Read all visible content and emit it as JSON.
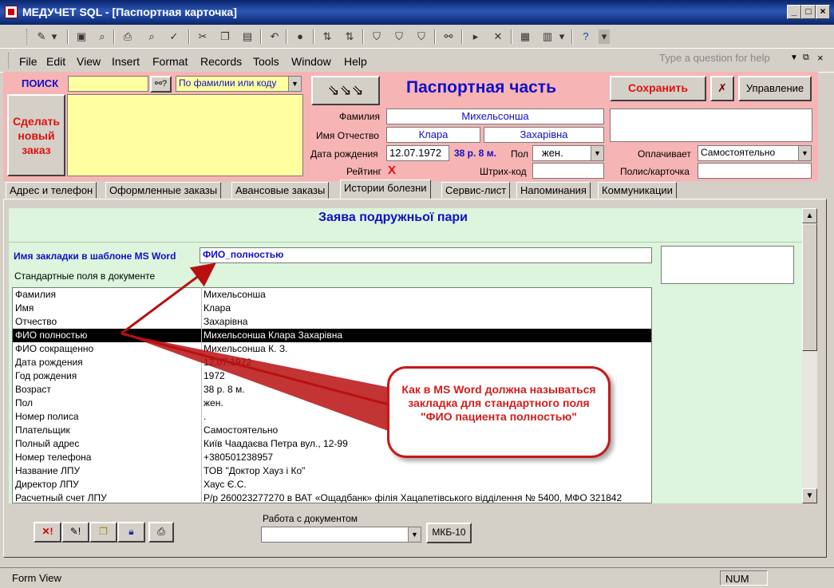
{
  "window": {
    "title": "МЕДУЧЕТ SQL - [Паспортная карточка]"
  },
  "menu": [
    "File",
    "Edit",
    "View",
    "Insert",
    "Format",
    "Records",
    "Tools",
    "Window",
    "Help"
  ],
  "help_placeholder": "Type a question for help",
  "search": {
    "label": "ПОИСК",
    "value": "",
    "mode": "По фамилии или коду"
  },
  "new_order_button": "Сделать новый заказ",
  "section_title": "Паспортная часть",
  "save_button": "Сохранить",
  "manage_button": "Управление",
  "patient": {
    "surname_label": "Фамилия",
    "surname": "Михельсонша",
    "name_label": "Имя Отчество",
    "first_name": "Клара",
    "patronymic": "Захарівна",
    "dob_label": "Дата рождения",
    "dob": "12.07.1972",
    "age": "38 р. 8 м.",
    "sex_label": "Пол",
    "sex": "жен.",
    "rating_label": "Рейтинг",
    "rating_mark": "X",
    "barcode_label": "Штрих-код",
    "barcode": "",
    "payer_label": "Оплачивает",
    "payer": "Самостоятельно",
    "policy_label": "Полис/карточка",
    "policy": ""
  },
  "tabs": [
    "Адрес и телефон",
    "Оформленные заказы",
    "Авансовые заказы",
    "Истории болезни",
    "Сервис-лист",
    "Напоминания",
    "Коммуникации"
  ],
  "active_tab": 3,
  "form": {
    "heading": "Заява подружньої пари",
    "bookmark_label": "Имя закладки в шаблоне MS Word",
    "bookmark_value": "ФИО_полностью",
    "std_fields_label": "Стандартные поля в документе",
    "rows": [
      {
        "k": "Фамилия",
        "v": "Михельсонша"
      },
      {
        "k": "Имя",
        "v": "Клара"
      },
      {
        "k": "Отчество",
        "v": "Захарівна"
      },
      {
        "k": "ФИО полностью",
        "v": "Михельсонша Клара Захарівна"
      },
      {
        "k": "ФИО сокращенно",
        "v": "Михельсонша К. З."
      },
      {
        "k": "Дата рождения",
        "v": "12.07.1972"
      },
      {
        "k": "Год рождения",
        "v": "1972"
      },
      {
        "k": "Возраст",
        "v": "38 р. 8 м."
      },
      {
        "k": "Пол",
        "v": "жен."
      },
      {
        "k": "Номер полиса",
        "v": "."
      },
      {
        "k": "Плательщик",
        "v": "Самостоятельно"
      },
      {
        "k": "Полный адрес",
        "v": "Київ  Чаадаєва Петра вул., 12-99"
      },
      {
        "k": "Номер телефона",
        "v": "+380501238957"
      },
      {
        "k": "Название ЛПУ",
        "v": "ТОВ \"Доктор Хауз і Ко\""
      },
      {
        "k": "Директор ЛПУ",
        "v": "Хаус Є.С."
      },
      {
        "k": "Расчетный счет ЛПУ",
        "v": "Р/р 260023277270 в ВАТ «Ощадбанк» філія Хацапетівського відділення № 5400, МФО 321842"
      }
    ],
    "selected_row": 3
  },
  "doc_work_label": "Работа с документом",
  "doc_work_value": "",
  "mkb_button": "МКБ-10",
  "callout": "Как в MS Word должна называться закладка для стандартного поля \"ФИО пациента полностью\"",
  "status": {
    "left": "Form View",
    "right": "NUM"
  },
  "colors": {
    "header_bg": "#f7b4b4",
    "form_bg": "#dcf5dc",
    "accent_blue": "#1010c8",
    "accent_red": "#d41c1c"
  }
}
